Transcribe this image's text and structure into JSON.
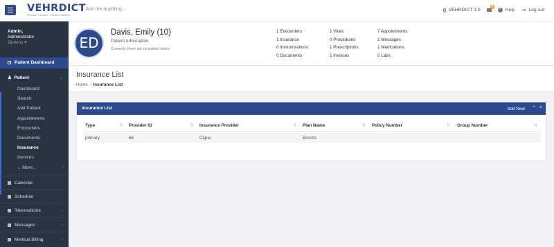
{
  "app": {
    "logo": "VEHRDICT",
    "tagline": "Provider Focused  ·  Patient Centered",
    "search_placeholder": "Ask me anything ...",
    "version": "VEHRDICT 3.0",
    "mail_badge": "0",
    "help_label": "Help",
    "logout_label": "Log out"
  },
  "user": {
    "name": "Admin,",
    "role": "Administrator",
    "options": "Options ▾"
  },
  "sidebar": {
    "dashboard": "Patient Dashboard",
    "patient": "Patient",
    "sub_items": [
      "Dashboard",
      "Search",
      "Add Patient",
      "Appointments",
      "Encounters",
      "Documents",
      "Insurance",
      "Invoices",
      "More..."
    ],
    "active_sub": "Insurance",
    "sections": [
      "Calendar",
      "Schedule",
      "Telemedicine",
      "Messages",
      "Medical Billing"
    ]
  },
  "patient": {
    "initials": "ED",
    "name": "Davis, Emily (10)",
    "info_label": "Patient Information",
    "notes": "Currently, there are no patient notes.",
    "stats": [
      [
        "1 Encounters",
        "1 Vitals",
        "7 Appointments"
      ],
      [
        "1 Insurance",
        "0 Procedures",
        "1 Messages"
      ],
      [
        "0 Immunizations",
        "1 Prescriptions",
        "1 Medications"
      ],
      [
        "0 Documents",
        "1 Invoices",
        "0 Labs"
      ]
    ]
  },
  "page": {
    "title": "Insurance List",
    "breadcrumb_home": "Home",
    "breadcrumb_current": "Insurance List"
  },
  "panel": {
    "title": "Insurance List",
    "add_new": "Add New",
    "columns": [
      "Type",
      "Provider ID",
      "Insurance Provider",
      "Plan Name",
      "Policy Number",
      "Group Number"
    ],
    "rows": [
      [
        "primary",
        "66",
        "Cigna",
        "Bronze",
        "",
        ""
      ]
    ]
  },
  "colors": {
    "brand": "#2c4a8e",
    "sidebar_bg": "#2a3340",
    "accent_border": "#3e6fd6"
  }
}
